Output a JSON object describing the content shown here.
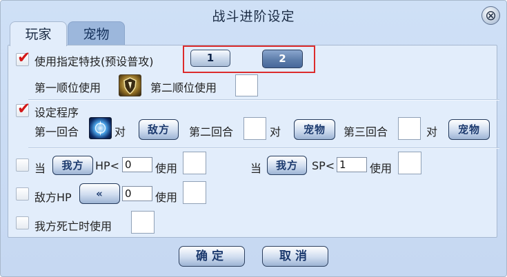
{
  "window": {
    "title": "战斗进阶设定",
    "close_glyph": "⊗"
  },
  "tabs": [
    {
      "label": "玩家",
      "active": true
    },
    {
      "label": "宠物",
      "active": false
    }
  ],
  "skill": {
    "checkbox_label": "使用指定特技(预设普攻)",
    "checked": true,
    "option1": "1",
    "option2": "2",
    "selected": "2",
    "first_label": "第一顺位使用",
    "second_label": "第二顺位使用",
    "first_icon": "shield-skill-icon"
  },
  "program": {
    "checkbox_label": "设定程序",
    "checked": true,
    "round1_label": "第一回合",
    "round1_icon": "orb-skill-icon",
    "vs": "对",
    "round1_target": "敌方",
    "round2_label": "第二回合",
    "round2_target": "宠物",
    "round3_label": "第三回合",
    "round3_target": "宠物"
  },
  "conditions": {
    "hp_prefix": "当",
    "hp_target": "我方",
    "hp_label": "HP<",
    "hp_value": "0",
    "use_label": "使用",
    "sp_prefix": "当",
    "sp_target": "我方",
    "sp_label": "SP<",
    "sp_value": "1",
    "enemy_hp_label": "敌方HP",
    "enemy_hp_value": "0",
    "death_label": "我方死亡时使用"
  },
  "footer": {
    "ok": "确定",
    "cancel": "取消"
  },
  "colors": {
    "accent_red": "#d31818",
    "panel": "#e2edfb",
    "background": "#c6d8f2"
  }
}
